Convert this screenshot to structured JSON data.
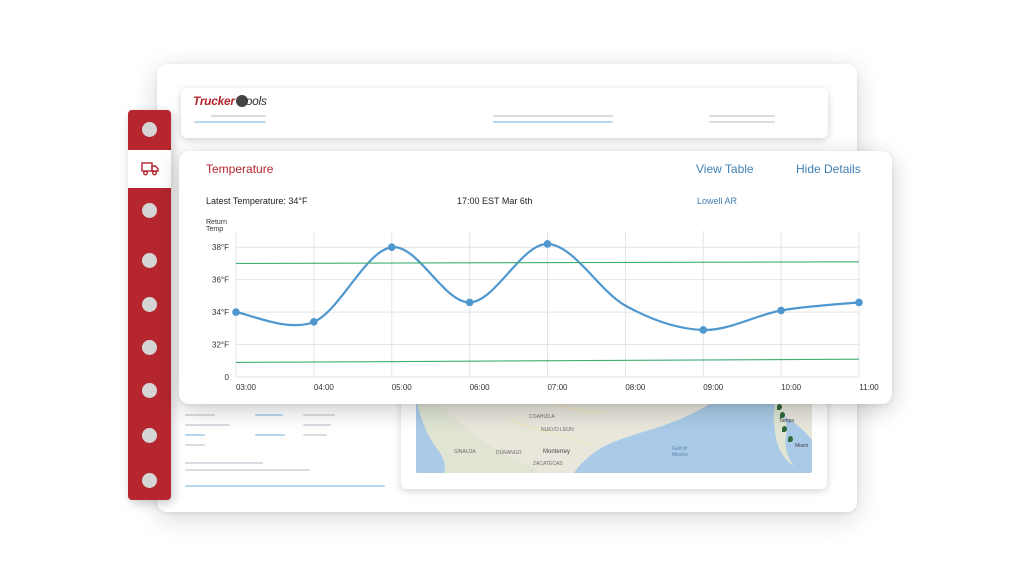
{
  "brand": {
    "logo_part1": "Trucker",
    "logo_part2": "ools",
    "accent": "#b3262d"
  },
  "sidebar": {
    "active_icon": "truck-icon",
    "color": "#b5262e"
  },
  "temperature_panel": {
    "title": "Temperature",
    "view_table_label": "View Table",
    "hide_details_label": "Hide Details",
    "latest_temperature": "Latest Temperature: 34°F",
    "timestamp": "17:00 EST Mar 6th",
    "location": "Lowell AR"
  },
  "map": {
    "labels": [
      "COAHUILA",
      "NUEVO LEON",
      "SINALOA",
      "DURANGO",
      "Monterrey",
      "ZACATECAS",
      "Gulf of Mexico",
      "Tampa",
      "Miami"
    ]
  },
  "chart_data": {
    "type": "line",
    "ylabel": "Return Temp",
    "x": [
      "03:00",
      "04:00",
      "05:00",
      "06:00",
      "07:00",
      "08:00",
      "09:00",
      "10:00",
      "11:00"
    ],
    "y_ticks": [
      "0",
      "32°F",
      "34°F",
      "36°F",
      "38°F"
    ],
    "series": [
      {
        "color": "#4e97cf",
        "points": [
          {
            "x": 3.0,
            "y": 34.0
          },
          {
            "x": 4.0,
            "y": 33.4
          },
          {
            "x": 5.0,
            "y": 38.0
          },
          {
            "x": 6.0,
            "y": 34.6
          },
          {
            "x": 7.0,
            "y": 38.2
          },
          {
            "x": 8.0,
            "y": 34.4
          },
          {
            "x": 9.0,
            "y": 32.9
          },
          {
            "x": 10.0,
            "y": 34.1
          },
          {
            "x": 11.0,
            "y": 34.6
          }
        ]
      },
      {
        "color": "#3fae72",
        "points": [
          {
            "x": 3.0,
            "y": 37.0
          },
          {
            "x": 11.0,
            "y": 37.1
          }
        ]
      },
      {
        "color": "#3fae72",
        "points": [
          {
            "x": 3.0,
            "y": 30.9
          },
          {
            "x": 11.0,
            "y": 31.1
          }
        ]
      }
    ],
    "marker_x": [
      3,
      4,
      5,
      6,
      7,
      9,
      10,
      11
    ],
    "ylim": [
      30,
      39
    ],
    "xlim": [
      3,
      11
    ],
    "grid": true
  }
}
